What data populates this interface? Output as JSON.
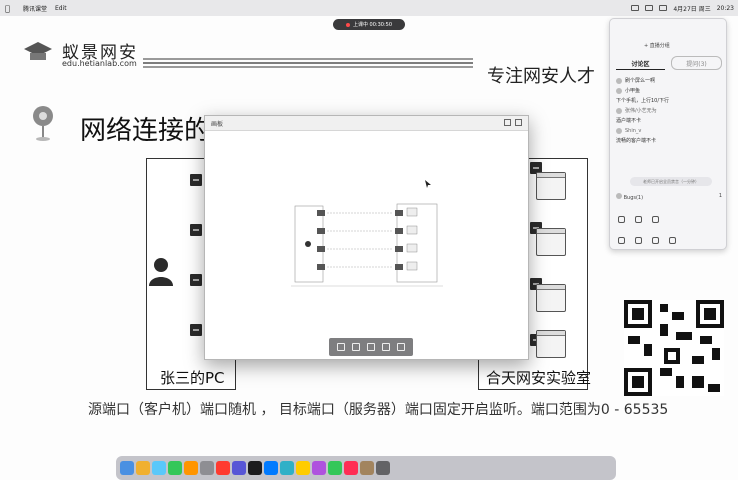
{
  "menubar": {
    "app_name": "腾讯课堂",
    "menu_edit": "Edit",
    "clock": "20:23",
    "date": "4月27日 周三"
  },
  "recording": {
    "label": "上课中 00:30:50"
  },
  "slide": {
    "logo_cn": "蚁景网安",
    "logo_url": "edu.hetianlab.com",
    "slogan": "专注网安人才",
    "title": "网络连接的",
    "pc_label": "张三的PC",
    "lab_label": "合天网安实验室",
    "caption": "源端口（客户机）端口随机 ， 目标端口（服务器）端口固定开启监听。端口范围为0 - 65535"
  },
  "popup": {
    "title": "画板"
  },
  "chat": {
    "live_label": "+ 直播分组",
    "tab_discussion": "讨论区",
    "tab_questions": "提问(3)",
    "messages": [
      {
        "text": "刷个屏么一啊",
        "sys": false
      },
      {
        "text": "小甲鱼",
        "sys": false
      },
      {
        "text": "下个手机，上行10/下行",
        "sys": false
      },
      {
        "text": "张伟/小艺无为",
        "sys": true
      },
      {
        "text": "酒户端不卡",
        "sys": false
      },
      {
        "text": "Shin_v",
        "sys": true
      },
      {
        "text": "流畅的客户端不卡",
        "sys": false
      }
    ],
    "notice": "老师已开启全员禁言（一分钟）",
    "bottom_user": "Bugs(1)",
    "counter": "1"
  },
  "colors": {
    "slide_bg": "#fdfdfd",
    "dark_square": "#2b2b2b",
    "toolbar": "#7e7e80"
  }
}
